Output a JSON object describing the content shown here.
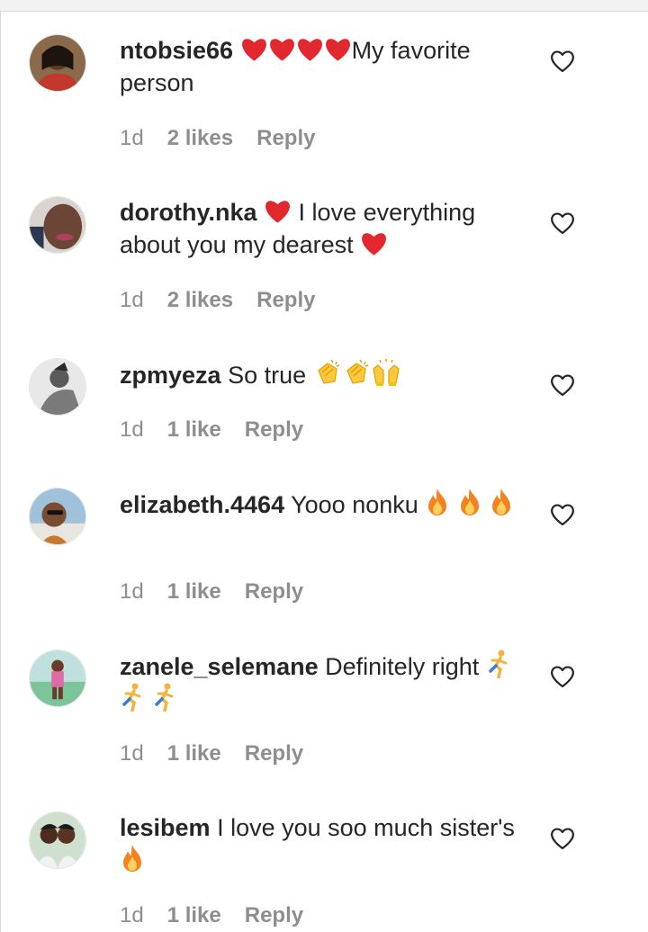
{
  "comments": [
    {
      "username": "ntobsie66",
      "text": "My favorite person",
      "time": "1d",
      "likes": "2 likes",
      "reply": "Reply",
      "emojis": [
        "red-heart",
        "red-heart",
        "red-heart",
        "red-heart"
      ]
    },
    {
      "username": "dorothy.nka",
      "text_a": "I love everything about you my dearest",
      "time": "1d",
      "likes": "2 likes",
      "reply": "Reply",
      "emojis": [
        "red-heart",
        "red-heart"
      ]
    },
    {
      "username": "zpmyeza",
      "text": "So true",
      "time": "1d",
      "likes": "1 like",
      "reply": "Reply",
      "emojis": [
        "clapping-hands",
        "clapping-hands",
        "raising-hands"
      ]
    },
    {
      "username": "elizabeth.4464",
      "text": "Yooo nonku",
      "time": "1d",
      "likes": "1 like",
      "reply": "Reply",
      "emojis": [
        "fire",
        "fire",
        "fire"
      ]
    },
    {
      "username": "zanele_selemane",
      "text": "Definitely right",
      "time": "1d",
      "likes": "1 like",
      "reply": "Reply",
      "emojis": [
        "person-running",
        "person-running",
        "person-running"
      ]
    },
    {
      "username": "lesibem",
      "text": "I love you soo much sister's",
      "time": "1d",
      "likes": "1 like",
      "reply": "Reply",
      "emojis": [
        "fire"
      ]
    }
  ],
  "colors": {
    "text": "#262626",
    "meta": "#8e8e8e",
    "heart_emoji": "#e0282e",
    "fire": "#f7a21b",
    "clap": "#ffc83d"
  }
}
